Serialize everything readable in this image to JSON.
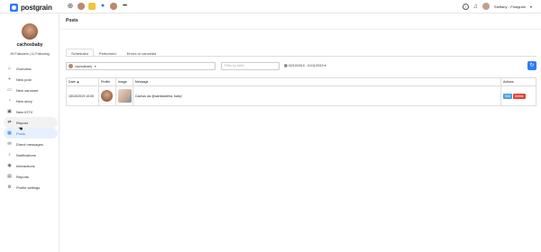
{
  "app": {
    "logo_text": "postgrain"
  },
  "topbar": {
    "user_name": "Steffany - Postgrain",
    "caret": "▾"
  },
  "profile": {
    "username": "cachosbaby",
    "stats": "99 Followers  |  11 Following"
  },
  "sidebar": {
    "items": [
      {
        "label": "Overview",
        "icon": "home-icon",
        "glyph": "⌂"
      },
      {
        "label": "New post",
        "icon": "plus-icon",
        "glyph": "+"
      },
      {
        "label": "New carousel",
        "icon": "carousel-icon",
        "glyph": "▭"
      },
      {
        "label": "New story",
        "icon": "story-icon",
        "glyph": "◔"
      },
      {
        "label": "New IGTV",
        "icon": "tv-icon",
        "glyph": "▣"
      },
      {
        "label": "Repost",
        "icon": "repost-icon",
        "glyph": "⇄"
      },
      {
        "label": "Posts",
        "icon": "calendar-icon",
        "glyph": "▦"
      },
      {
        "label": "Direct messages",
        "icon": "message-icon",
        "glyph": "✉"
      },
      {
        "label": "Notifications",
        "icon": "bell-icon",
        "glyph": "♪"
      },
      {
        "label": "Interactions",
        "icon": "interactions-icon",
        "glyph": "◉"
      },
      {
        "label": "Reports",
        "icon": "reports-icon",
        "glyph": "▤"
      },
      {
        "label": "Profile settings",
        "icon": "gear-icon",
        "glyph": "⚙"
      }
    ]
  },
  "main": {
    "title": "Posts",
    "tabs": [
      {
        "label": "Scheduled"
      },
      {
        "label": "Performed"
      },
      {
        "label": "Errors or canceled"
      }
    ],
    "filters": {
      "account": "cachosbaby",
      "label_placeholder": "Filter by label",
      "date_range": "02/10/2019 - 01/11/2019"
    },
    "table": {
      "headers": [
        "Date ▲",
        "Profile",
        "Image",
        "Message",
        "Actions"
      ],
      "rows": [
        {
          "date": "15/10/2019 10:00",
          "message": "Cachos da @camilaoteira, baby!",
          "edit": "Edit",
          "delete": "Delete"
        }
      ]
    }
  },
  "colors": {
    "accent": "#2e7cf6",
    "danger": "#e0443b",
    "edit": "#4ba3e3"
  }
}
